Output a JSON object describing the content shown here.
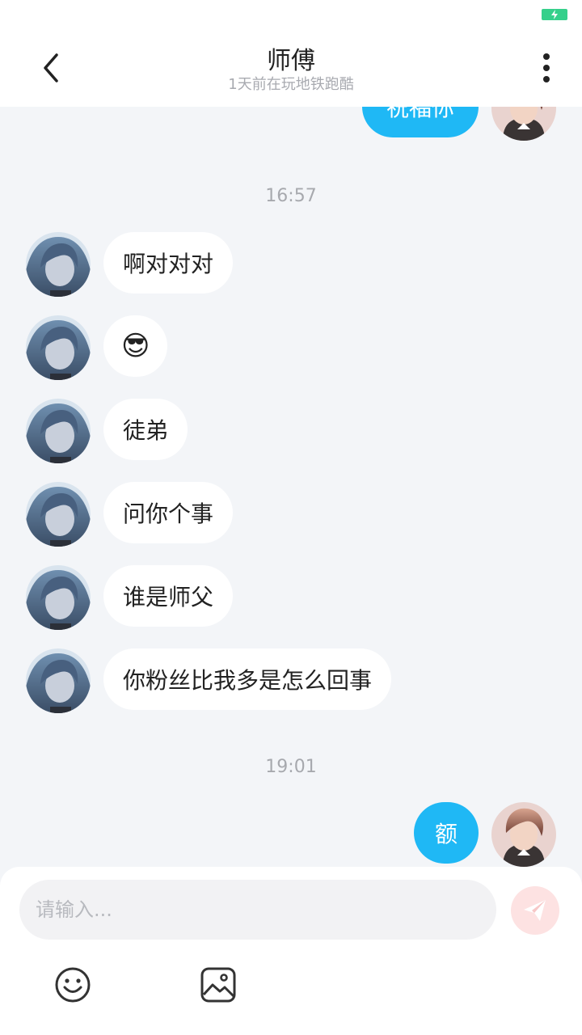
{
  "header": {
    "title": "师傅",
    "subtitle": "1天前在玩地铁跑酷"
  },
  "chat": {
    "partial_message": "祝福你",
    "time_1": "16:57",
    "messages_1": [
      "啊对对对",
      "😎",
      "徒弟",
      "问你个事",
      "谁是师父",
      "你粉丝比我多是怎么回事"
    ],
    "time_2": "19:01",
    "my_message": "额"
  },
  "input": {
    "placeholder": "请输入..."
  },
  "icons": {
    "back": "chevron-left-icon",
    "more": "more-vertical-icon",
    "send": "paper-plane-icon",
    "emoji": "smiley-icon",
    "image": "image-icon",
    "battery": "battery-charging-icon"
  },
  "colors": {
    "my_bubble": "#1fb8f5",
    "their_bubble": "#ffffff",
    "background": "#f3f5f8",
    "battery": "#35d08b",
    "send_button": "#fde2e2"
  }
}
